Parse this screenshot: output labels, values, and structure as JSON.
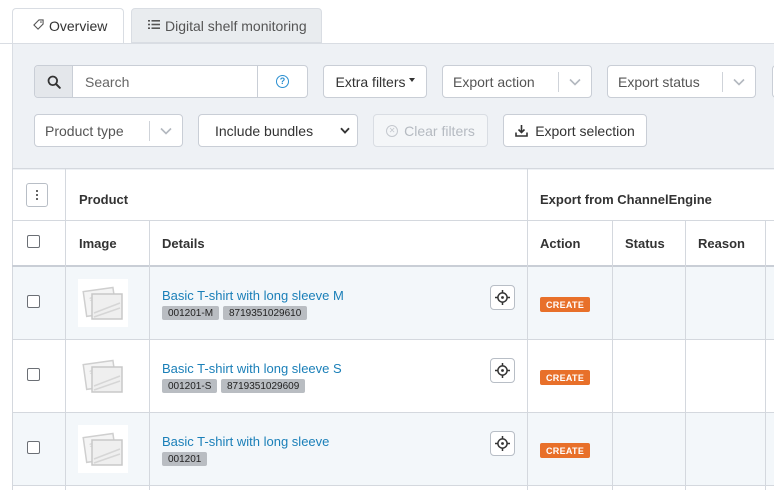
{
  "tabs": [
    {
      "label": "Overview",
      "icon": "tag-icon",
      "active": true
    },
    {
      "label": "Digital shelf monitoring",
      "icon": "list-icon",
      "active": false
    }
  ],
  "filters": {
    "search_placeholder": "Search",
    "extra_filters_label": "Extra filters",
    "export_action_label": "Export action",
    "export_status_label": "Export status",
    "product_type_label": "Product type",
    "include_bundles_label": "Include bundles",
    "clear_filters_label": "Clear filters",
    "export_selection_label": "Export selection"
  },
  "table": {
    "group_headers": {
      "product": "Product",
      "export": "Export from ChannelEngine"
    },
    "columns": {
      "image": "Image",
      "details": "Details",
      "action": "Action",
      "status": "Status",
      "reason": "Reason"
    },
    "rows": [
      {
        "name": "Basic T-shirt with long sleeve M",
        "tags": [
          "001201-M",
          "8719351029610"
        ],
        "action": "CREATE"
      },
      {
        "name": "Basic T-shirt with long sleeve S",
        "tags": [
          "001201-S",
          "8719351029609"
        ],
        "action": "CREATE"
      },
      {
        "name": "Basic T-shirt with long sleeve",
        "tags": [
          "001201"
        ],
        "action": "CREATE"
      }
    ]
  },
  "colors": {
    "link": "#1a7fb8",
    "badge": "#e8702a",
    "panel": "#eef1f5",
    "row_bg": "#f3f7fa"
  }
}
